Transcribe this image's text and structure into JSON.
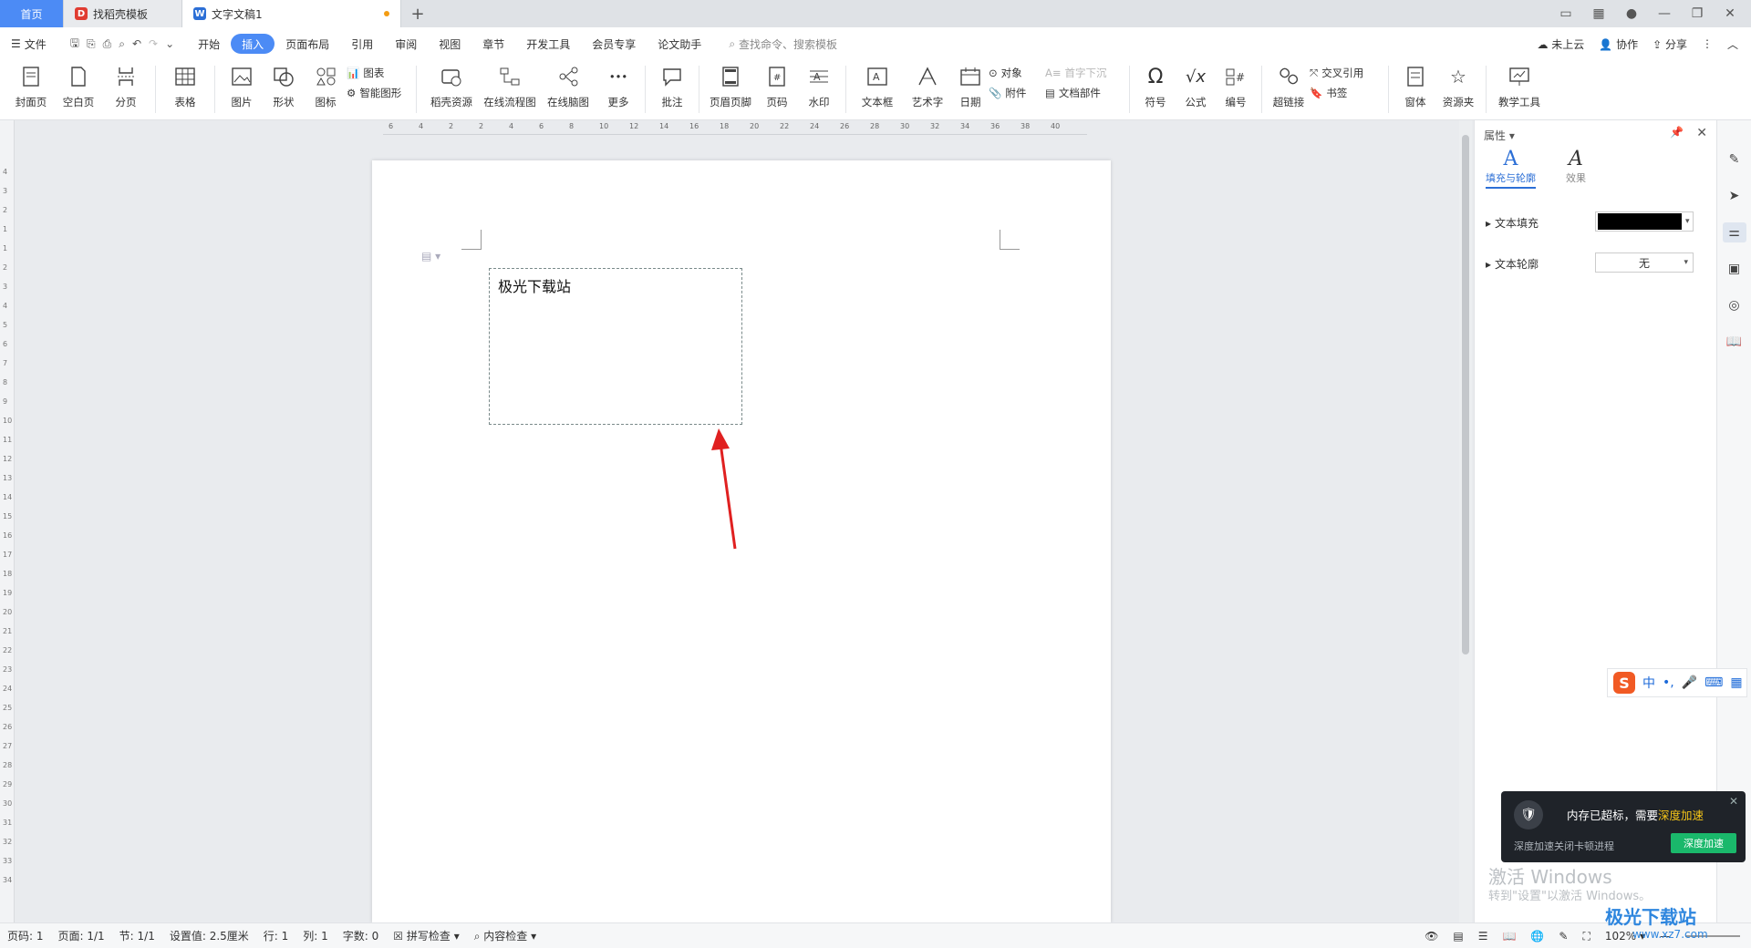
{
  "tabs": {
    "home": "首页",
    "template": "找稻壳模板",
    "document": "文字文稿1",
    "add": "+"
  },
  "menu": {
    "file": "文件",
    "items": [
      "开始",
      "插入",
      "页面布局",
      "引用",
      "审阅",
      "视图",
      "章节",
      "开发工具",
      "会员专享",
      "论文助手"
    ],
    "active": "插入",
    "search_placeholder": "查找命令、搜索模板",
    "cloud": "未上云",
    "collab": "协作",
    "share": "分享"
  },
  "ribbon": {
    "cover": "封面页",
    "blank": "空白页",
    "break": "分页",
    "table": "表格",
    "picture": "图片",
    "shape": "形状",
    "icon": "图标",
    "chart": "图表",
    "smart": "智能图形",
    "docer": "稻壳资源",
    "flowchart": "在线流程图",
    "mindmap": "在线脑图",
    "more": "更多",
    "comment": "批注",
    "header_footer": "页眉页脚",
    "page_num": "页码",
    "watermark": "水印",
    "textbox": "文本框",
    "wordart": "艺术字",
    "date": "日期",
    "object": "对象",
    "dropcap": "首字下沉",
    "attach": "附件",
    "docparts": "文档部件",
    "symbol": "符号",
    "formula": "公式",
    "numbering": "编号",
    "hyperlink": "超链接",
    "crossref": "交叉引用",
    "bookmark": "书签",
    "window": "窗体",
    "resource": "资源夹",
    "teaching": "教学工具"
  },
  "ruler": {
    "top": [
      "6",
      "4",
      "2",
      "2",
      "4",
      "6",
      "8",
      "10",
      "12",
      "14",
      "16",
      "18",
      "20",
      "22",
      "24",
      "26",
      "28",
      "30",
      "32",
      "34",
      "36",
      "38",
      "40"
    ],
    "left": [
      "4",
      "3",
      "2",
      "1",
      "1",
      "2",
      "3",
      "4",
      "5",
      "6",
      "7",
      "8",
      "9",
      "10",
      "11",
      "12",
      "13",
      "14",
      "15",
      "16",
      "17",
      "18",
      "19",
      "20",
      "21",
      "22",
      "23",
      "24",
      "25",
      "26",
      "27",
      "28",
      "29",
      "30",
      "31",
      "32",
      "33",
      "34"
    ]
  },
  "document": {
    "textbox_text": "极光下载站"
  },
  "panel": {
    "title": "属性",
    "tab_fill": "填充与轮廓",
    "tab_effect": "效果",
    "text_fill_label": "文本填充",
    "text_fill_color": "#000000",
    "text_outline_label": "文本轮廓",
    "text_outline_value": "无"
  },
  "ime": {
    "mode": "中"
  },
  "notification": {
    "title": "内存已超标，需要",
    "highlight": "深度加速",
    "subtitle": "深度加速关闭卡顿进程",
    "button": "深度加速"
  },
  "activation": {
    "line1": "激活 Windows",
    "line2": "转到\"设置\"以激活 Windows。"
  },
  "status": {
    "page_code": "页码: 1",
    "pages": "页面: 1/1",
    "section": "节: 1/1",
    "setting": "设置值: 2.5厘米",
    "row": "行: 1",
    "col": "列: 1",
    "words": "字数: 0",
    "spell": "拼写检查",
    "content_check": "内容检查",
    "zoom": "102%"
  },
  "brand": {
    "logo": "极光下载站",
    "url": "www.xz7.com"
  },
  "colors": {
    "accent": "#4c8bf5",
    "arrow": "#e02020"
  }
}
